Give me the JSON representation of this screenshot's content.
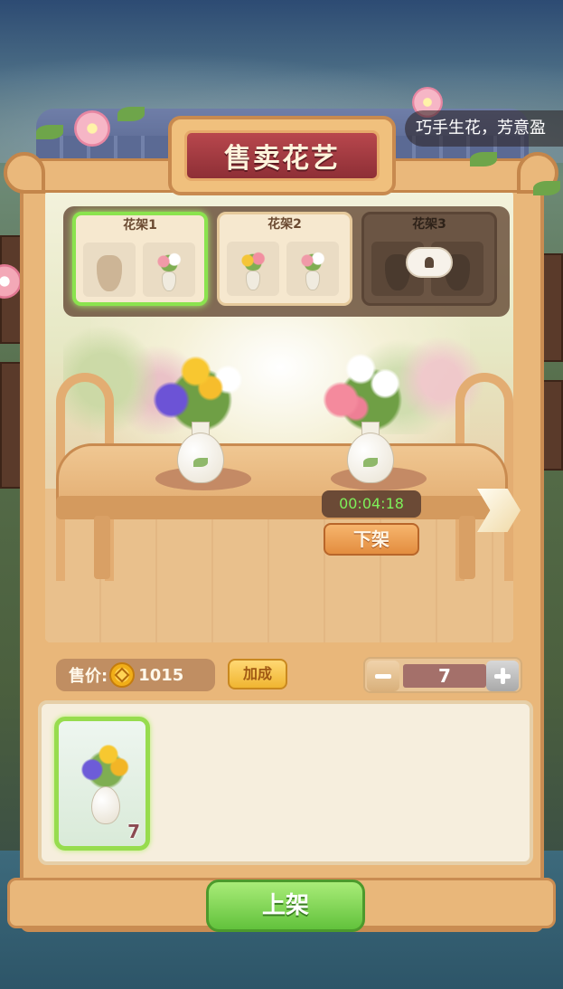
{
  "header": {
    "title": "售卖花艺",
    "marquee": "巧手生花，芳意盈"
  },
  "shelves": [
    {
      "label": "花架1",
      "state": "active",
      "slots": [
        "empty",
        "bouquet-pink"
      ]
    },
    {
      "label": "花架2",
      "state": "normal",
      "slots": [
        "bouquet-yellow",
        "bouquet-pink"
      ]
    },
    {
      "label": "花架3",
      "state": "locked",
      "slots": [
        "empty",
        "empty"
      ]
    }
  ],
  "table": {
    "left_vase": "bouquet-purple-yellow",
    "right_vase": "bouquet-pink-white",
    "timer": "00:04:18",
    "unshelve_label": "下架"
  },
  "controls": {
    "price_label": "售价:",
    "price_value": "1015",
    "bonus_label": "加成",
    "quantity": "7"
  },
  "inventory": {
    "items": [
      {
        "name": "bouquet-purple-yellow",
        "count": "7",
        "selected": true
      }
    ]
  },
  "footer": {
    "shelve_label": "上架"
  },
  "colors": {
    "title_plaque": "#9e3a41",
    "active_border": "#8be34e",
    "timer_text": "#7ef05a",
    "shelve_button": "#62c23c",
    "cabinet_wood": "#e9b77a"
  },
  "icons": {
    "coin": "coin-icon",
    "minus": "minus-icon",
    "plus": "plus-icon",
    "next": "arrow-right-icon",
    "lock": "lock-icon"
  }
}
